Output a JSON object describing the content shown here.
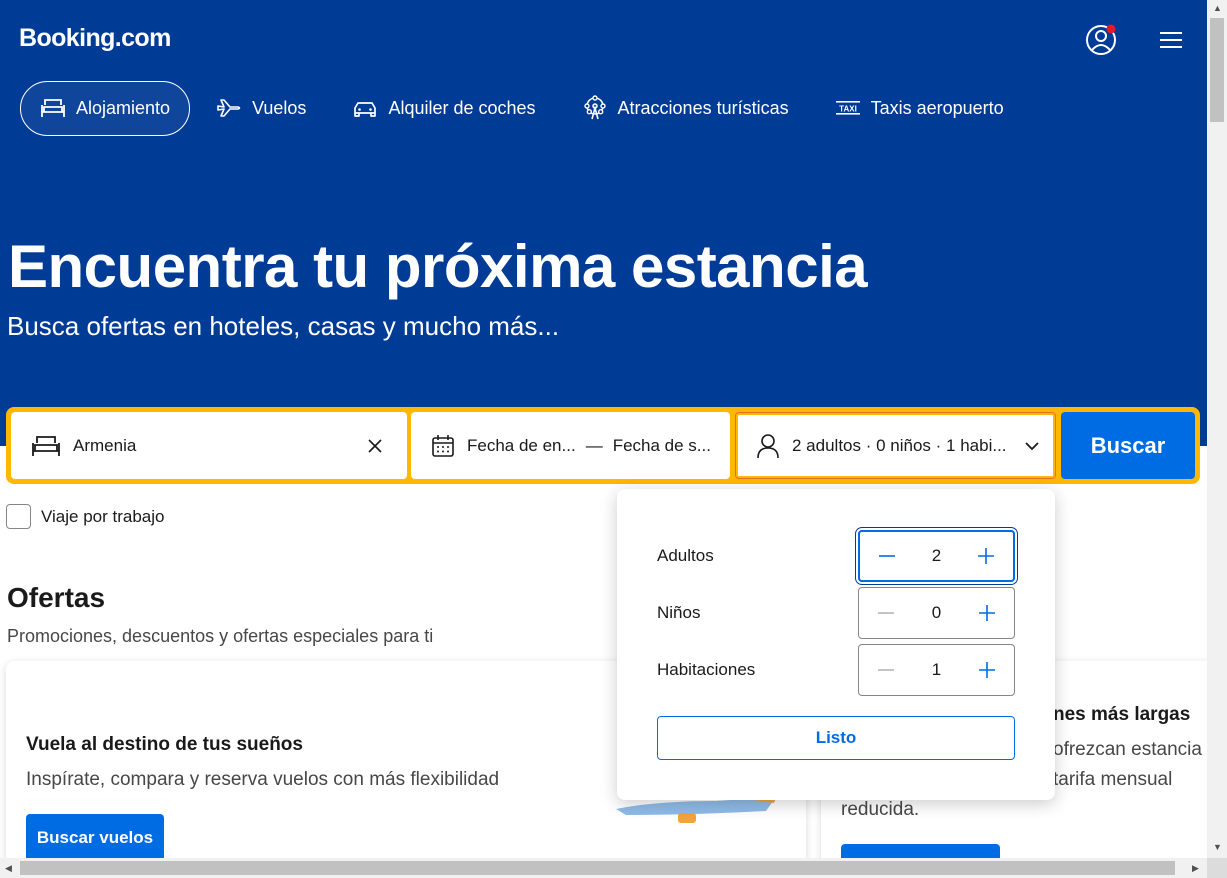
{
  "header": {
    "logo": "Booking.com",
    "user_icon": "user-circle-icon",
    "menu_icon": "hamburger-menu-icon",
    "notification_color": "#e21c24"
  },
  "nav": {
    "items": [
      {
        "label": "Alojamiento",
        "icon": "bed-icon",
        "active": true
      },
      {
        "label": "Vuelos",
        "icon": "plane-icon"
      },
      {
        "label": "Alquiler de coches",
        "icon": "car-icon"
      },
      {
        "label": "Atracciones turísticas",
        "icon": "ferris-wheel-icon"
      },
      {
        "label": "Taxis aeropuerto",
        "icon": "taxi-icon"
      }
    ]
  },
  "hero": {
    "title": "Encuentra tu próxima estancia",
    "subtitle": "Busca ofertas en hoteles, casas y mucho más..."
  },
  "search": {
    "destination": "Armenia",
    "checkin": "Fecha de en...",
    "dash": "—",
    "checkout": "Fecha de s...",
    "guests": "2 adultos · 0 niños · 1 habi...",
    "button": "Buscar"
  },
  "work_trip": {
    "label": "Viaje por trabajo",
    "checked": false
  },
  "offers": {
    "title": "Ofertas",
    "subtitle": "Promociones, descuentos y ofertas especiales para ti",
    "card1": {
      "title": "Vuela al destino de tus sueños",
      "text": "Inspírate, compara y reserva vuelos con más flexibilidad",
      "button": "Buscar vuelos"
    },
    "card2": {
      "title_partial": "nes más largas",
      "line1": "ofrezcan estancia",
      "line2": "tarifa mensual",
      "line3": "reducida."
    }
  },
  "guests_popup": {
    "rows": [
      {
        "label": "Adultos",
        "value": "2"
      },
      {
        "label": "Niños",
        "value": "0"
      },
      {
        "label": "Habitaciones",
        "value": "1"
      }
    ],
    "done": "Listo"
  },
  "colors": {
    "brand_blue": "#003b95",
    "action_blue": "#006ce4",
    "search_border": "#ffb700"
  }
}
